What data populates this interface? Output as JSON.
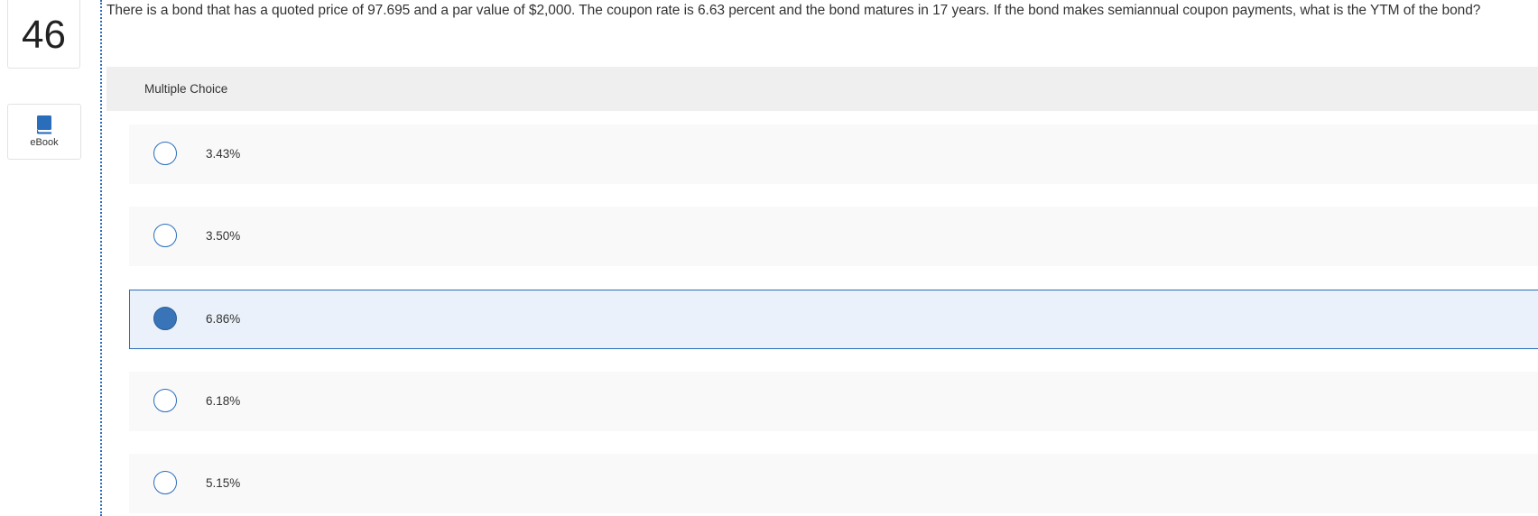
{
  "question": {
    "number": "46",
    "text": "There is a bond that has a quoted price of 97.695 and a par value of $2,000. The coupon rate is 6.63 percent and the bond matures in 17 years. If the bond makes semiannual coupon payments, what is the YTM of the bond?"
  },
  "sidebar": {
    "ebook_label": "eBook",
    "ebook_icon": "book-icon"
  },
  "multiple_choice": {
    "header": "Multiple Choice",
    "options": [
      {
        "label": "3.43%",
        "selected": false
      },
      {
        "label": "3.50%",
        "selected": false
      },
      {
        "label": "6.86%",
        "selected": true
      },
      {
        "label": "6.18%",
        "selected": false
      },
      {
        "label": "5.15%",
        "selected": false
      }
    ]
  },
  "colors": {
    "accent": "#2a6ebb",
    "selected_fill": "#3a74b8",
    "selected_background": "#eaf1fa"
  }
}
